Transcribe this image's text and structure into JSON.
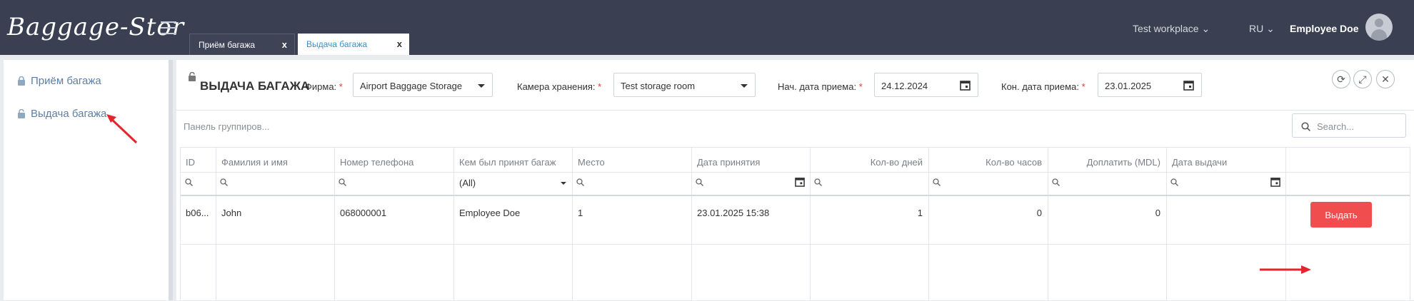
{
  "app": {
    "logo": "Baggage-Stor"
  },
  "tabs": [
    {
      "label": "Приём багажа",
      "close": "x"
    },
    {
      "label": "Выдача багажа",
      "close": "x"
    }
  ],
  "header": {
    "workplace": "Test workplace ⌄",
    "language": "RU ⌄",
    "user": "Employee Doe"
  },
  "sidebar": {
    "items": [
      {
        "label": "Приём багажа",
        "icon": "lock-icon"
      },
      {
        "label": "Выдача багажа",
        "icon": "unlock-icon"
      }
    ]
  },
  "page": {
    "title": "ВЫДАЧА БАГАЖА",
    "filters": {
      "firm_label": "Фирма:",
      "firm_value": "Airport Baggage Storage",
      "storage_label": "Камера хранения:",
      "storage_value": "Test storage room",
      "start_date_label": "Нач. дата приема:",
      "start_date_value": "24.12.2024",
      "end_date_label": "Кон. дата приема:",
      "end_date_value": "23.01.2025",
      "required_mark": "*"
    },
    "group_panel": "Панель группиров...",
    "search_placeholder": "Search..."
  },
  "grid": {
    "columns": [
      "ID",
      "Фамилия и имя",
      "Номер телефона",
      "Кем был принят багаж",
      "Место",
      "Дата принятия",
      "Кол-во дней",
      "Кол-во часов",
      "Доплатить (MDL)",
      "Дата выдачи"
    ],
    "filter_all": "(All)",
    "rows": [
      {
        "id": "b06...",
        "name": "John",
        "phone": "068000001",
        "accepted_by": "Employee Doe",
        "place": "1",
        "accepted_date": "23.01.2025 15:38",
        "days": "1",
        "hours": "0",
        "surcharge": "0",
        "issue_date": "",
        "action": "Выдать"
      }
    ]
  },
  "colors": {
    "topbar": "#3a3f51",
    "accent": "#3b8fc4",
    "danger": "#f04d4f",
    "annotation": "#e3262b"
  }
}
